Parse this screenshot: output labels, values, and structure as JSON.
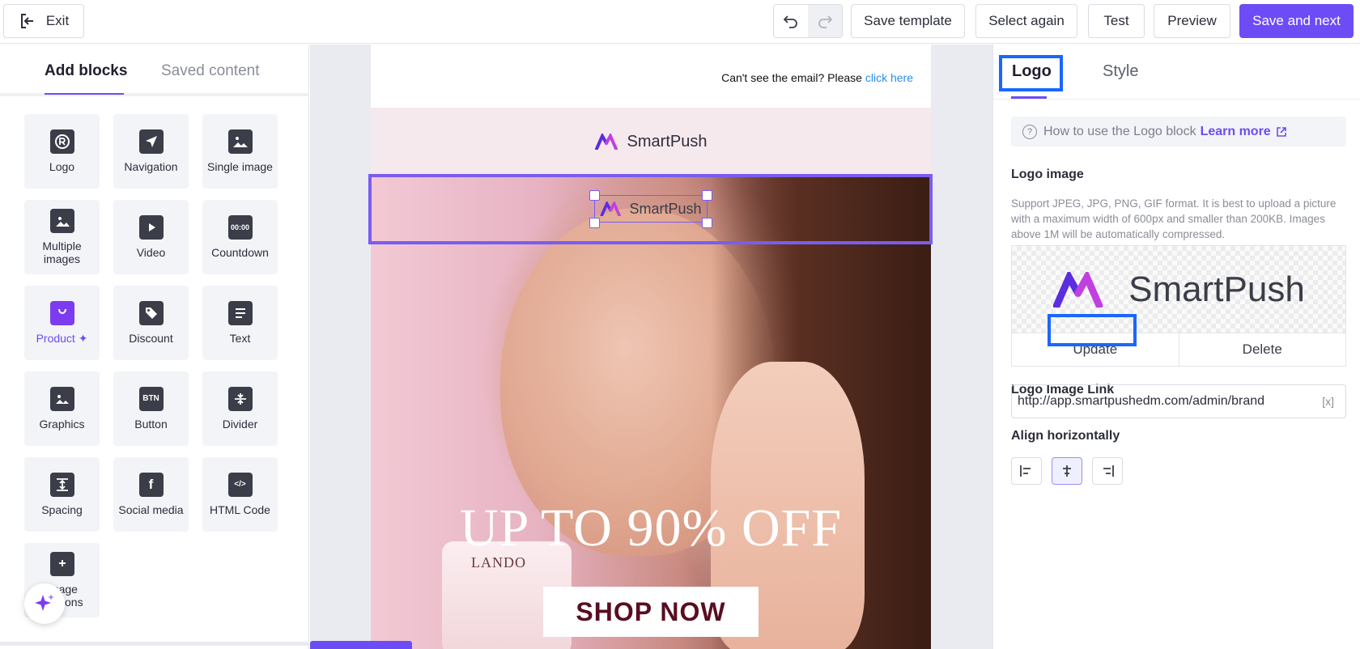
{
  "topbar": {
    "exit_label": "Exit",
    "save_template": "Save template",
    "select_again": "Select again",
    "test": "Test",
    "preview": "Preview",
    "save_next": "Save and next"
  },
  "left_panel": {
    "tabs": [
      "Add blocks",
      "Saved content"
    ],
    "blocks": [
      {
        "label": "Logo",
        "icon": "logo-icon"
      },
      {
        "label": "Navigation",
        "icon": "navigation-icon"
      },
      {
        "label": "Single image",
        "icon": "image-icon"
      },
      {
        "label": "Multiple images",
        "icon": "images-icon"
      },
      {
        "label": "Video",
        "icon": "video-icon"
      },
      {
        "label": "Countdown",
        "icon": "countdown-icon"
      },
      {
        "label": "Product",
        "icon": "product-icon"
      },
      {
        "label": "Discount",
        "icon": "discount-icon"
      },
      {
        "label": "Text",
        "icon": "text-icon"
      },
      {
        "label": "Graphics",
        "icon": "graphics-icon"
      },
      {
        "label": "Button",
        "icon": "button-icon"
      },
      {
        "label": "Divider",
        "icon": "divider-icon"
      },
      {
        "label": "Spacing",
        "icon": "spacing-icon"
      },
      {
        "label": "Social media",
        "icon": "social-media-icon"
      },
      {
        "label": "HTML Code",
        "icon": "html-code-icon"
      },
      {
        "label": "Image captions",
        "icon": "image-captions-icon"
      }
    ],
    "countdown_glyph": "00:00",
    "button_glyph": "BTN"
  },
  "canvas": {
    "preheader": "Can't see the email? Please",
    "preheader_link": "click here",
    "brand_name": "SmartPush",
    "headline": "UP TO 90% OFF",
    "cta": "SHOP NOW",
    "jar_label": "LANDO"
  },
  "right_panel": {
    "tabs": [
      "Logo",
      "Style"
    ],
    "help_text": "How to use the Logo block",
    "learn_more": "Learn more",
    "logo_image_title": "Logo image",
    "logo_image_desc": "Support JPEG, JPG, PNG, GIF format. It is best to upload a picture with a maximum width of 600px and smaller than 200KB. Images above 1M will be automatically compressed.",
    "preview_brand": "SmartPush",
    "update": "Update",
    "delete": "Delete",
    "link_title": "Logo Image Link",
    "link_value": "http://app.smartpushedm.com/admin/brand",
    "var_token": "[x]",
    "align_title": "Align horizontally",
    "align_selected": "center"
  },
  "colors": {
    "accent": "#6d4cf5",
    "highlight": "#1a66ff",
    "link": "#2a8cf0"
  }
}
